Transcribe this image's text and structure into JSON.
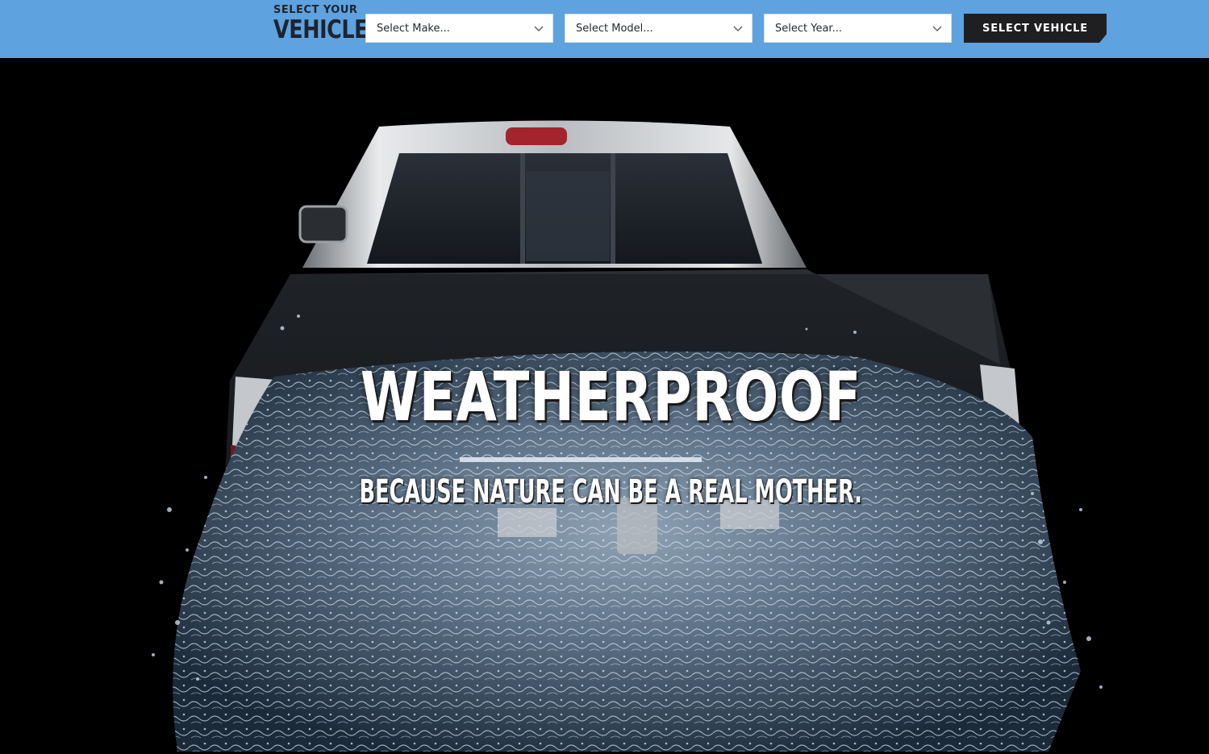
{
  "vehicle_selector": {
    "brand_small": "SELECT YOUR",
    "brand_big": "VEHICLE",
    "make_placeholder": "Select Make...",
    "model_placeholder": "Select Model...",
    "year_placeholder": "Select Year...",
    "button_label": "SELECT VEHICLE"
  },
  "hero": {
    "headline": "WEATHERPROOF",
    "subhead": "BECAUSE NATURE CAN BE A REAL MOTHER."
  },
  "colors": {
    "topbar": "#5ea2df",
    "button": "#1f1f21",
    "hero_background": "#000000"
  }
}
